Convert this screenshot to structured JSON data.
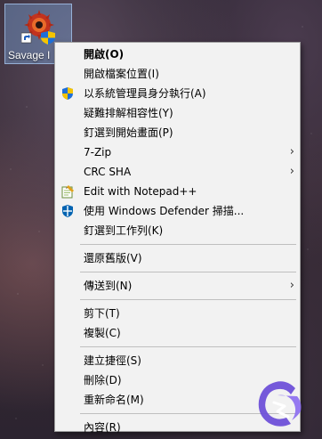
{
  "desktop": {
    "icon_label": "Savage I"
  },
  "menu": {
    "group1": [
      {
        "label": "開啟(O)",
        "bold": true
      },
      {
        "label": "開啟檔案位置(I)"
      },
      {
        "label": "以系統管理員身分執行(A)",
        "icon": "uac-shield-icon"
      },
      {
        "label": "疑難排解相容性(Y)"
      },
      {
        "label": "釘選到開始畫面(P)"
      },
      {
        "label": "7-Zip",
        "submenu": true
      },
      {
        "label": "CRC SHA",
        "submenu": true
      },
      {
        "label": "Edit with Notepad++",
        "icon": "notepad-plus-plus-icon"
      },
      {
        "label": "使用 Windows Defender 掃描...",
        "icon": "windows-defender-icon"
      },
      {
        "label": "釘選到工作列(K)"
      }
    ],
    "group2": [
      {
        "label": "還原舊版(V)"
      }
    ],
    "group3": [
      {
        "label": "傳送到(N)",
        "submenu": true
      }
    ],
    "group4": [
      {
        "label": "剪下(T)"
      },
      {
        "label": "複製(C)"
      }
    ],
    "group5": [
      {
        "label": "建立捷徑(S)"
      },
      {
        "label": "刪除(D)"
      },
      {
        "label": "重新命名(M)"
      }
    ],
    "group6": [
      {
        "label": "內容(R)"
      }
    ],
    "chevron_glyph": "›"
  },
  "colors": {
    "menu_background": "#f2f2f2",
    "separator": "#bfbfbf",
    "selection_box": "#78a0d2",
    "uac_blue": "#1e6fd9",
    "uac_yellow": "#f5c400",
    "defender_blue": "#0063b1",
    "watermark_purple": "#6a4cd8"
  }
}
